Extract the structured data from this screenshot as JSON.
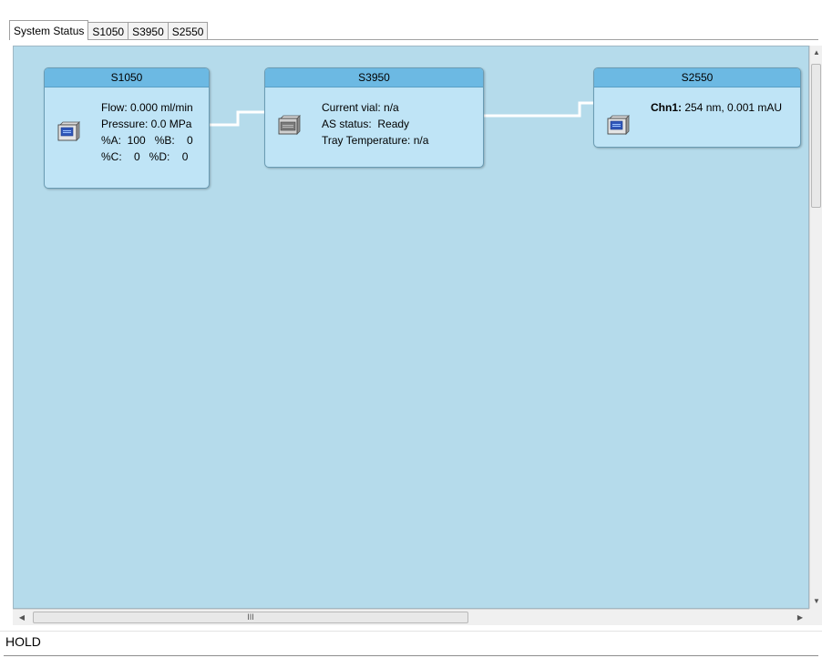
{
  "tabs": [
    {
      "label": "System Status",
      "active": true
    },
    {
      "label": "S1050",
      "active": false
    },
    {
      "label": "S3950",
      "active": false
    },
    {
      "label": "S2550",
      "active": false
    }
  ],
  "modules": {
    "pump": {
      "title": "S1050",
      "icon": "pump-icon",
      "lines": [
        "Flow: 0.000 ml/min",
        "Pressure: 0.0 MPa",
        "%A:  100   %B:    0",
        "%C:    0   %D:    0"
      ]
    },
    "autosampler": {
      "title": "S3950",
      "icon": "autosampler-icon",
      "lines": [
        "Current vial: n/a",
        "AS status:  Ready",
        "Tray Temperature: n/a"
      ]
    },
    "detector": {
      "title": "S2550",
      "icon": "detector-icon",
      "channel_label": "Chn1:",
      "channel_value": " 254 nm, 0.001 mAU"
    }
  },
  "scroll": {
    "h_thumb_grip": "III"
  },
  "status": {
    "text": "HOLD"
  },
  "colors": {
    "canvas_bg": "#b5dbeb",
    "module_bg": "#bfe4f6",
    "module_header": "#6cb9e3",
    "connector": "#ffffff"
  }
}
